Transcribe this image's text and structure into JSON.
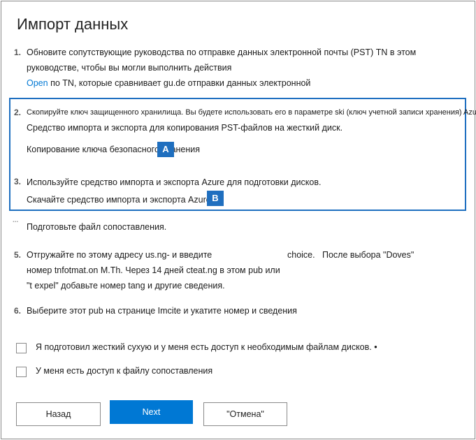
{
  "dialog": {
    "title": "Импорт данных"
  },
  "steps": [
    {
      "num": "1.",
      "line1": "Обновите сопутствующие руководства по отправке данных электронной почты (PST) TN в этом",
      "line2": "руководстве, чтобы вы могли выполнить действия",
      "link": "Open",
      "line3_rest": "по TN, которые сравнивает gu.de отправки данных электронной"
    },
    {
      "num": "2.",
      "line1": "Скопируйте ключ защищенного хранилища. Вы будете использовать его в параметре ski (ключ учетной записи хранения) Azure",
      "line2": "Средство импорта и экспорта для копирования PST-файлов на жесткий диск.",
      "action": "Копирование ключа безопасного хранения"
    },
    {
      "num": "3.",
      "line1": "Используйте средство импорта и экспорта Azure для подготовки дисков.",
      "action": "Скачайте средство импорта и экспорта Azure"
    },
    {
      "num": "...",
      "line1": "Подготовьте файл сопоставления."
    },
    {
      "num": "5.",
      "line1a": "Отгружайте по этому адресу us.ng- и введите",
      "line1b": "choice.",
      "line1c": "После выбора \"Doves\"",
      "line2": "номер tnfotmat.on M.Th. Через 14 дней cteat.ng в этом pub или",
      "line3": "\"t expel\" добавьте номер tang и другие сведения."
    },
    {
      "num": "6.",
      "line1": "Выберите этот pub на странице Imcite и укатите номер и сведения"
    }
  ],
  "callouts": {
    "a": "A",
    "b": "B"
  },
  "checkboxes": [
    {
      "label": "Я подготовил жесткий сухую и у меня есть доступ к необходимым файлам дисков. •",
      "checked": false
    },
    {
      "label": "У меня есть доступ к файлу сопоставления",
      "checked": false
    }
  ],
  "buttons": {
    "back": "Назад",
    "next": "Next",
    "cancel": "\"Отмена\""
  },
  "colors": {
    "accent": "#0078d4",
    "highlight_border": "#1e6fc0",
    "callout": "#1f6fbf"
  }
}
